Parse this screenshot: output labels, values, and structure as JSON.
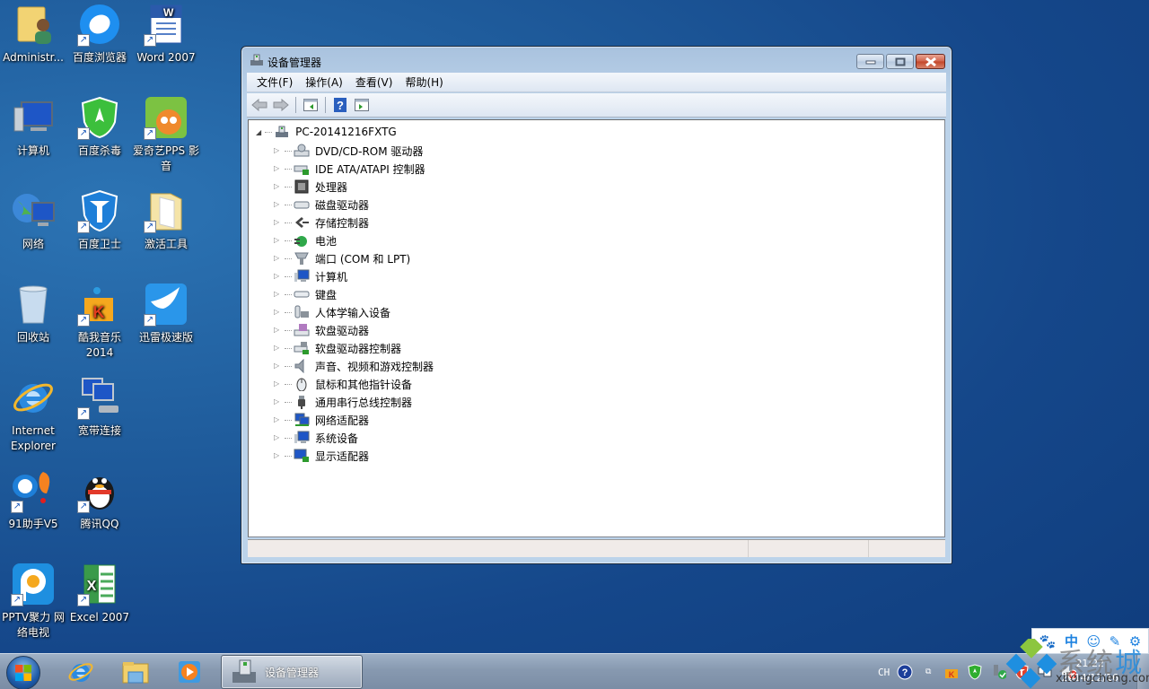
{
  "desktop": {
    "icons": [
      {
        "label": "Administr...",
        "icon": "user-folder-icon"
      },
      {
        "label": "百度浏览器",
        "icon": "baidu-browser-icon",
        "shortcut": true
      },
      {
        "label": "Word 2007",
        "icon": "word-icon",
        "shortcut": true
      },
      {
        "label": "计算机",
        "icon": "computer-icon"
      },
      {
        "label": "百度杀毒",
        "icon": "baidu-antivirus-icon",
        "shortcut": true
      },
      {
        "label": "爱奇艺PPS 影音",
        "icon": "pps-icon",
        "shortcut": true
      },
      {
        "label": "网络",
        "icon": "network-icon"
      },
      {
        "label": "百度卫士",
        "icon": "baidu-guard-icon",
        "shortcut": true
      },
      {
        "label": "激活工具",
        "icon": "folder-icon",
        "shortcut": true
      },
      {
        "label": "回收站",
        "icon": "recycle-bin-icon"
      },
      {
        "label": "酷我音乐 2014",
        "icon": "kuwo-music-icon",
        "shortcut": true
      },
      {
        "label": "迅雷极速版",
        "icon": "xunlei-icon",
        "shortcut": true
      },
      {
        "label": "Internet Explorer",
        "icon": "ie-icon"
      },
      {
        "label": "宽带连接",
        "icon": "broadband-icon",
        "shortcut": true
      },
      {
        "label": "91助手V5",
        "icon": "91-assistant-icon",
        "shortcut": true
      },
      {
        "label": "腾讯QQ",
        "icon": "qq-icon",
        "shortcut": true
      },
      {
        "label": "PPTV聚力 网络电视",
        "icon": "pptv-icon",
        "shortcut": true
      },
      {
        "label": "Excel 2007",
        "icon": "excel-icon",
        "shortcut": true
      }
    ]
  },
  "window": {
    "title": "设备管理器",
    "menu": [
      "文件(F)",
      "操作(A)",
      "查看(V)",
      "帮助(H)"
    ],
    "toolbar": [
      "back",
      "forward",
      "show-hide-console-tree",
      "help",
      "show-hide-action-pane"
    ],
    "tree": {
      "root": "PC-20141216FXTG",
      "items": [
        {
          "label": "DVD/CD-ROM 驱动器",
          "icon": "dvd-drive-icon"
        },
        {
          "label": "IDE ATA/ATAPI 控制器",
          "icon": "ide-controller-icon"
        },
        {
          "label": "处理器",
          "icon": "processor-icon"
        },
        {
          "label": "磁盘驱动器",
          "icon": "disk-drive-icon"
        },
        {
          "label": "存储控制器",
          "icon": "storage-controller-icon"
        },
        {
          "label": "电池",
          "icon": "battery-icon"
        },
        {
          "label": "端口 (COM 和 LPT)",
          "icon": "port-icon"
        },
        {
          "label": "计算机",
          "icon": "computer-icon"
        },
        {
          "label": "键盘",
          "icon": "keyboard-icon"
        },
        {
          "label": "人体学输入设备",
          "icon": "hid-icon"
        },
        {
          "label": "软盘驱动器",
          "icon": "floppy-drive-icon"
        },
        {
          "label": "软盘驱动器控制器",
          "icon": "floppy-controller-icon"
        },
        {
          "label": "声音、视频和游戏控制器",
          "icon": "sound-icon"
        },
        {
          "label": "鼠标和其他指针设备",
          "icon": "mouse-icon"
        },
        {
          "label": "通用串行总线控制器",
          "icon": "usb-icon"
        },
        {
          "label": "网络适配器",
          "icon": "network-adapter-icon"
        },
        {
          "label": "系统设备",
          "icon": "system-device-icon"
        },
        {
          "label": "显示适配器",
          "icon": "display-adapter-icon"
        }
      ]
    }
  },
  "taskbar": {
    "active_task": "设备管理器",
    "pinned": [
      "internet-explorer",
      "windows-explorer",
      "media-player"
    ],
    "tray": {
      "language": "CH",
      "clock_time": "21:22",
      "clock_date": "2014/12/16"
    }
  },
  "ime": {
    "buttons": [
      "🐾",
      "中",
      "☺",
      "✎",
      "⚙"
    ]
  },
  "watermark": {
    "text_gray": "系统",
    "text_blue": "城",
    "url": "xitongcheng.com"
  }
}
